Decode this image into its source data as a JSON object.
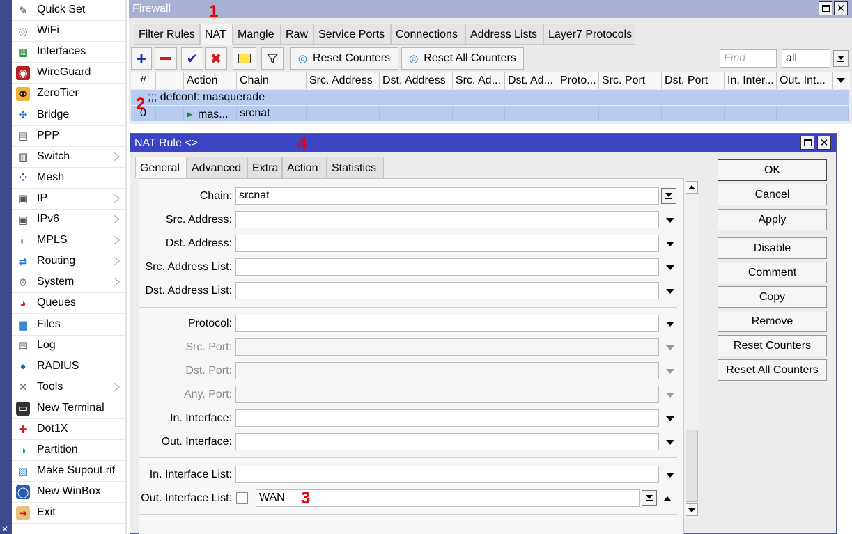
{
  "menu": {
    "items": [
      {
        "label": "Quick Set",
        "icon": "wand-icon",
        "sub": false
      },
      {
        "label": "WiFi",
        "icon": "wifi-icon",
        "sub": false
      },
      {
        "label": "Interfaces",
        "icon": "interfaces-icon",
        "sub": false
      },
      {
        "label": "WireGuard",
        "icon": "wireguard-icon",
        "sub": false
      },
      {
        "label": "ZeroTier",
        "icon": "zerotier-icon",
        "sub": false
      },
      {
        "label": "Bridge",
        "icon": "bridge-icon",
        "sub": false
      },
      {
        "label": "PPP",
        "icon": "ppp-icon",
        "sub": false
      },
      {
        "label": "Switch",
        "icon": "switch-icon",
        "sub": true
      },
      {
        "label": "Mesh",
        "icon": "mesh-icon",
        "sub": false
      },
      {
        "label": "IP",
        "icon": "ip-icon",
        "sub": true
      },
      {
        "label": "IPv6",
        "icon": "ipv6-icon",
        "sub": true
      },
      {
        "label": "MPLS",
        "icon": "mpls-icon",
        "sub": true
      },
      {
        "label": "Routing",
        "icon": "routing-icon",
        "sub": true
      },
      {
        "label": "System",
        "icon": "gear-icon",
        "sub": true
      },
      {
        "label": "Queues",
        "icon": "queues-icon",
        "sub": false
      },
      {
        "label": "Files",
        "icon": "folder-icon",
        "sub": false
      },
      {
        "label": "Log",
        "icon": "log-icon",
        "sub": false
      },
      {
        "label": "RADIUS",
        "icon": "radius-icon",
        "sub": false
      },
      {
        "label": "Tools",
        "icon": "tools-icon",
        "sub": true
      },
      {
        "label": "New Terminal",
        "icon": "terminal-icon",
        "sub": false
      },
      {
        "label": "Dot1X",
        "icon": "dot1x-icon",
        "sub": false
      },
      {
        "label": "Partition",
        "icon": "partition-icon",
        "sub": false
      },
      {
        "label": "Make Supout.rif",
        "icon": "supout-icon",
        "sub": false
      },
      {
        "label": "New WinBox",
        "icon": "winbox-icon",
        "sub": false
      },
      {
        "label": "Exit",
        "icon": "exit-icon",
        "sub": false
      }
    ]
  },
  "firewall": {
    "title": "Firewall",
    "tabs": [
      "Filter Rules",
      "NAT",
      "Mangle",
      "Raw",
      "Service Ports",
      "Connections",
      "Address Lists",
      "Layer7 Protocols"
    ],
    "active_tab": "NAT",
    "toolbar": {
      "reset_counters": "Reset Counters",
      "reset_all_counters": "Reset All Counters",
      "find_placeholder": "Find",
      "filter_value": "all"
    },
    "columns": [
      "#",
      "",
      "Action",
      "Chain",
      "Src. Address",
      "Dst. Address",
      "Src. Ad...",
      "Dst. Ad...",
      "Proto...",
      "Src. Port",
      "Dst. Port",
      "In. Inter...",
      "Out. Int..."
    ],
    "comment_row": ";;; defconf: masquerade",
    "rule": {
      "num": "0",
      "action": "mas...",
      "chain": "srcnat"
    }
  },
  "nat_rule": {
    "title": "NAT Rule <>",
    "tabs": [
      "General",
      "Advanced",
      "Extra",
      "Action",
      "Statistics"
    ],
    "active_tab": "General",
    "fields": {
      "chain_label": "Chain:",
      "chain_value": "srcnat",
      "src_address": "Src. Address:",
      "dst_address": "Dst. Address:",
      "src_address_list": "Src. Address List:",
      "dst_address_list": "Dst. Address List:",
      "protocol": "Protocol:",
      "src_port": "Src. Port:",
      "dst_port": "Dst. Port:",
      "any_port": "Any. Port:",
      "in_interface": "In. Interface:",
      "out_interface": "Out. Interface:",
      "in_interface_list": "In. Interface List:",
      "out_interface_list": "Out. Interface List:",
      "out_interface_list_value": "WAN"
    },
    "buttons": [
      "OK",
      "Cancel",
      "Apply",
      "Disable",
      "Comment",
      "Copy",
      "Remove",
      "Reset Counters",
      "Reset All Counters"
    ]
  },
  "annotations": [
    "1",
    "2",
    "3",
    "4"
  ],
  "colors": {
    "accent": "#3b44c2",
    "selected_row": "#b7ccef",
    "annotation": "#ee0000"
  }
}
